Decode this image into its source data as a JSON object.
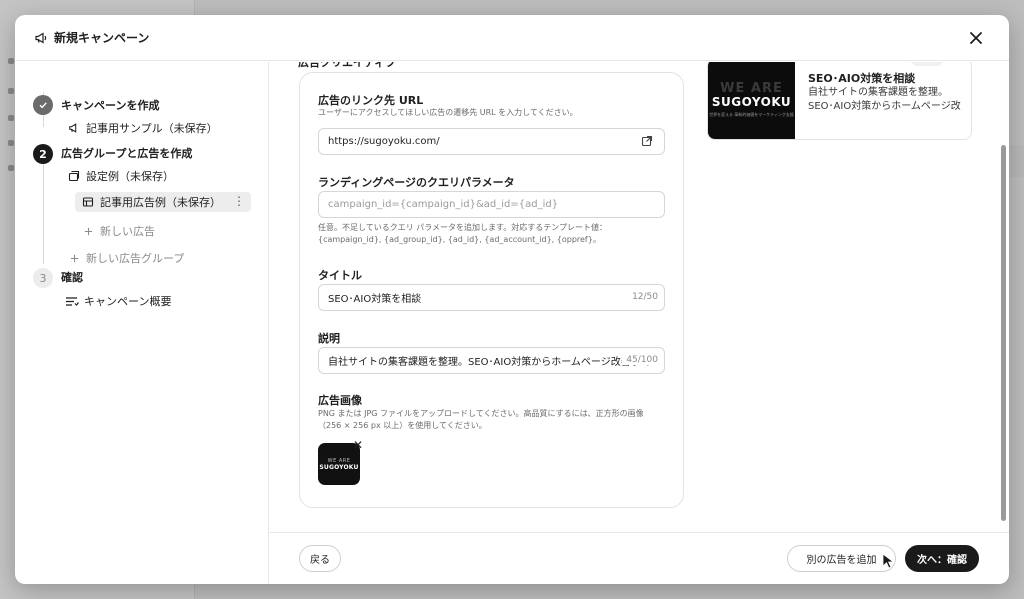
{
  "modal": {
    "title": "新規キャンペーン",
    "header_icon": "megaphone-icon",
    "close_icon": "close-icon"
  },
  "stepper": {
    "steps": [
      {
        "number": "✓",
        "label": "キャンペーンを作成",
        "state": "done",
        "items": [
          {
            "icon": "megaphone-icon",
            "label": "記事用サンプル（未保存）"
          }
        ]
      },
      {
        "number": "2",
        "label": "広告グループと広告を作成",
        "state": "active",
        "items": [
          {
            "icon": "ad-group-icon",
            "label": "設定例（未保存）"
          },
          {
            "icon": "ad-icon",
            "label": "記事用広告例（未保存）",
            "selected": true
          },
          {
            "icon": "plus-icon",
            "label": "新しい広告"
          },
          {
            "icon": "plus-icon",
            "label": "新しい広告グループ"
          }
        ]
      },
      {
        "number": "3",
        "label": "確認",
        "state": "todo",
        "items": [
          {
            "icon": "list-icon",
            "label": "キャンペーン概要"
          }
        ]
      }
    ]
  },
  "form": {
    "section_title": "広告クリエイティブ",
    "url": {
      "label": "広告のリンク先 URL",
      "help": "ユーザーにアクセスしてほしい広告の遷移先 URL を入力してください。",
      "value": "https://sugoyoku.com/"
    },
    "query": {
      "label": "ランディングページのクエリパラメータ",
      "placeholder": "campaign_id={campaign_id}&ad_id={ad_id}",
      "help": "任意。不足しているクエリ パラメータを追加します。対応するテンプレート値：{campaign_id}, {ad_group_id}, {ad_id}, {ad_account_id}, {oppref}。"
    },
    "title": {
      "label": "タイトル",
      "value": "SEO･AIO対策を相談",
      "counter": "12/50"
    },
    "description": {
      "label": "説明",
      "value": "自社サイトの集客課題を整理。SEO･AIO対策からホームページ改善まで",
      "counter": "45/100"
    },
    "image": {
      "label": "広告画像",
      "help": "PNG または JPG ファイルをアップロードしてください。高品質にするには、正方形の画像（256 × 256 px 以上）を使用してください。",
      "thumb_line1": "WE ARE",
      "thumb_line2": "SUGOYOKU"
    }
  },
  "preview": {
    "image_line1": "WE ARE",
    "image_line2": "SUGOYOKU",
    "image_line3": "世界を変える 革新的価値をマーケティング支援",
    "title": "SEO･AIO対策を相談",
    "description": "自社サイトの集客課題を整理。SEO･AIO対策からホームページ改"
  },
  "footer": {
    "back_label": "戻る",
    "add_ad_label": "別の広告を追加",
    "next_label": "次へ：確認"
  }
}
